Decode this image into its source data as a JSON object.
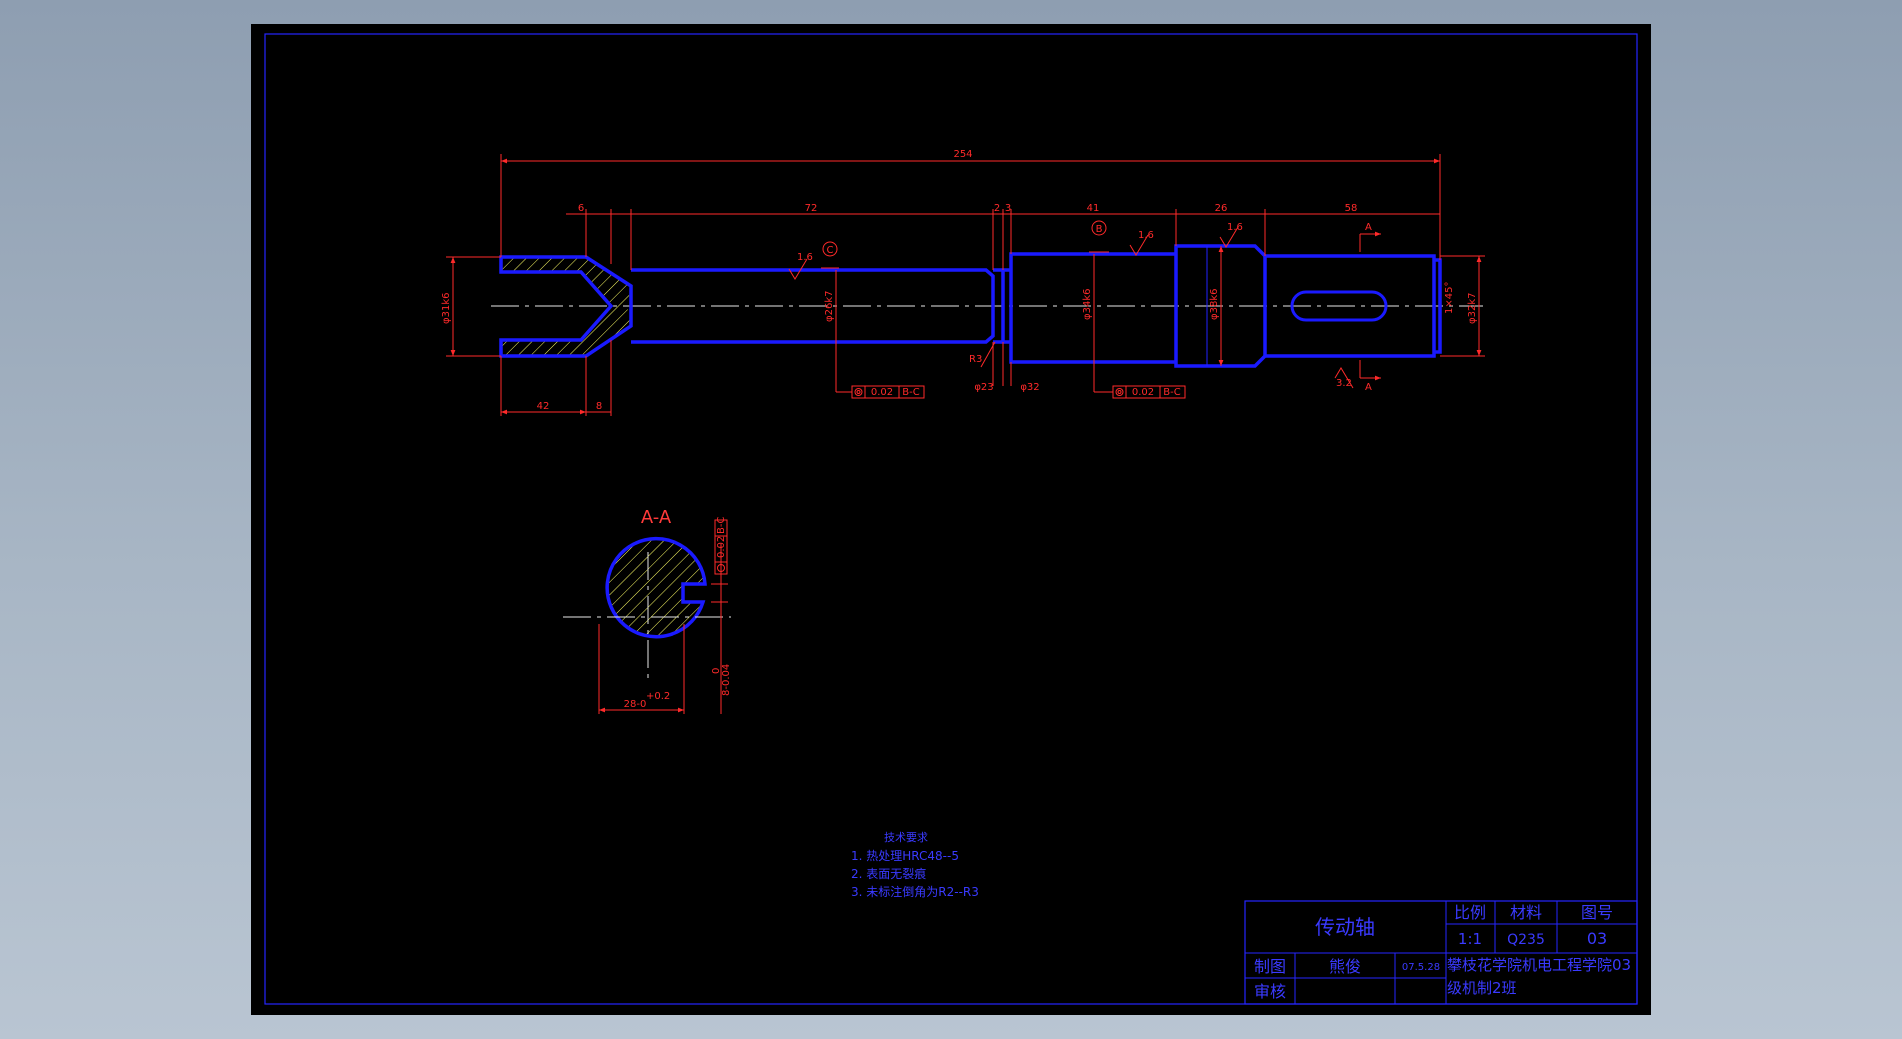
{
  "drawing": {
    "section_label": "A-A",
    "dimensions": {
      "overall_length": "254",
      "fork_slot": "6",
      "shaft_seg_1": "72",
      "groove_1": "2",
      "groove_2": "3",
      "seg_bearing": "41",
      "seg_shoulder": "26",
      "seg_key": "58",
      "fork_length": "42",
      "fork_neck": "8",
      "dia_fork": "φ31k6",
      "dia_1": "φ26k7",
      "dia_2": "φ34k6",
      "dia_3": "φ38k6",
      "dia_4": "φ32k7",
      "dia_groove_1": "φ23",
      "dia_groove_2": "φ32",
      "fillet": "R3",
      "chamfer": "1×45°",
      "roughness_1": "1.6",
      "roughness_2": "1.6",
      "roughness_3": "1.6",
      "roughness_4": "3.2",
      "section_width": "28-0",
      "section_width_tol": "+0.2",
      "key_width": "8-0.04",
      "key_width_tol": "0",
      "datum_c": "C",
      "datum_b": "B",
      "section_mark_top": "A",
      "section_mark_bottom": "A",
      "tolerance_1_value": "0.02",
      "tolerance_1_datum": "B-C",
      "tolerance_2_value": "0.02",
      "tolerance_2_datum": "B-C",
      "tolerance_key": "0.02",
      "tolerance_key_datum": "B-C"
    },
    "tech_notes": {
      "title": "技术要求",
      "items": [
        "1. 热处理HRC48--5",
        "2. 表面无裂痕",
        "3. 未标注倒角为R2--R3"
      ]
    }
  },
  "title_block": {
    "part_name": "传动轴",
    "scale_label": "比例",
    "scale_value": "1:1",
    "material_label": "材料",
    "material_value": "Q235",
    "drawing_no_label": "图号",
    "drawing_no_value": "03",
    "drawn_by_label": "制图",
    "drawn_by_name": "熊俊",
    "date": "07.5.28",
    "checked_by_label": "审核",
    "school": "攀枝花学院机电工程学院03级机制2班"
  },
  "colors": {
    "sheet": "#000000",
    "geometry": "#1a1aff",
    "dimension": "#ff2a2a",
    "hatch": "#ffff66",
    "centerline": "#e8e8e8",
    "background": "#a8b6c5"
  }
}
